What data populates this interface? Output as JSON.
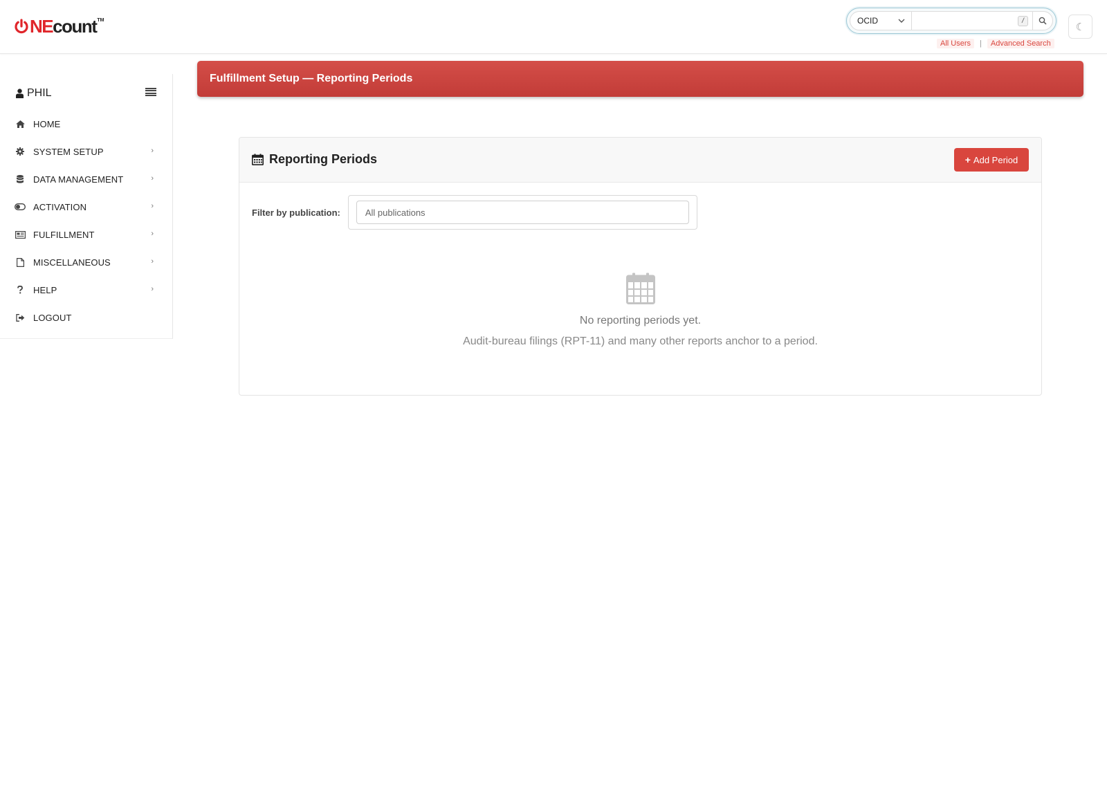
{
  "brand": {
    "part1": "NE",
    "part2": "count",
    "tm": "TM"
  },
  "search": {
    "type_selected": "OCID",
    "placeholder": "",
    "shortcut": "/"
  },
  "header_links": {
    "all_users": "All Users",
    "separator": "|",
    "advanced": "Advanced Search"
  },
  "theme_toggle": "☾",
  "user": {
    "name": "PHIL"
  },
  "nav": {
    "items": [
      {
        "label": "HOME",
        "icon": "home-icon",
        "arrow": ""
      },
      {
        "label": "SYSTEM SETUP",
        "icon": "gear-icon",
        "arrow": "›"
      },
      {
        "label": "DATA MANAGEMENT",
        "icon": "database-icon",
        "arrow": "›"
      },
      {
        "label": "ACTIVATION",
        "icon": "toggle-icon",
        "arrow": "›"
      },
      {
        "label": "FULFILLMENT",
        "icon": "newspaper-icon",
        "arrow": "›"
      },
      {
        "label": "MISCELLANEOUS",
        "icon": "file-icon",
        "arrow": "›"
      },
      {
        "label": "HELP",
        "icon": "question-icon",
        "arrow": "›"
      },
      {
        "label": "LOGOUT",
        "icon": "logout-icon",
        "arrow": ""
      }
    ]
  },
  "page": {
    "title": "Fulfillment Setup — Reporting Periods"
  },
  "card": {
    "title": "Reporting Periods",
    "add_button": "Add Period",
    "filter_label": "Filter by publication:",
    "filter_value": "All publications",
    "empty_title": "No reporting periods yet.",
    "empty_desc": "Audit-bureau filings (RPT-11) and many other reports anchor to a period."
  },
  "colors": {
    "accent": "#d9463e",
    "brand_red": "#e0262b",
    "search_border": "#9cc8d6"
  }
}
